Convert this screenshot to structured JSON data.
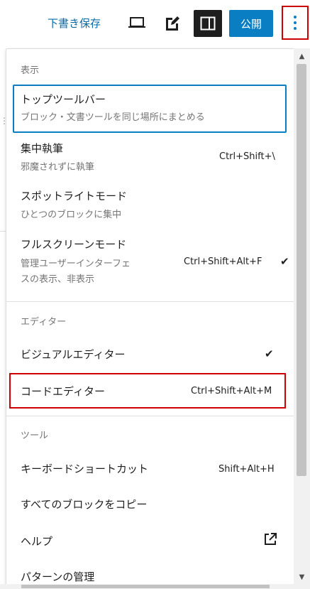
{
  "toolbar": {
    "save_draft": "下書き保存",
    "publish": "公開",
    "icons": [
      "laptop-icon",
      "edit-icon",
      "sidebar-toggle-icon",
      "more-options-icon"
    ]
  },
  "menu": {
    "view_section": {
      "label": "表示",
      "items": [
        {
          "title": "トップツールバー",
          "desc": "ブロック・文書ツールを同じ場所にまとめる"
        },
        {
          "title": "集中執筆",
          "desc": "邪魔されずに執筆",
          "shortcut": "Ctrl+Shift+\\"
        },
        {
          "title": "スポットライトモード",
          "desc": "ひとつのブロックに集中"
        },
        {
          "title": "フルスクリーンモード",
          "desc_line1": "管理ユーザーインターフェ",
          "desc_line2": "スの表示、非表示",
          "shortcut": "Ctrl+Shift+Alt+F",
          "check": "✔"
        }
      ]
    },
    "editor_section": {
      "label": "エディター",
      "items": [
        {
          "title": "ビジュアルエディター",
          "check": "✔"
        },
        {
          "title": "コードエディター",
          "shortcut": "Ctrl+Shift+Alt+M"
        }
      ]
    },
    "tools_section": {
      "label": "ツール",
      "items": [
        {
          "title": "キーボードショートカット",
          "shortcut": "Shift+Alt+H"
        },
        {
          "title": "すべてのブロックをコピー"
        },
        {
          "title": "ヘルプ"
        },
        {
          "title": "パターンの管理"
        }
      ]
    }
  },
  "colors": {
    "accent": "#0a7ec2",
    "highlight": "#cc0000",
    "text": "#1e1e1e",
    "muted": "#757575"
  }
}
